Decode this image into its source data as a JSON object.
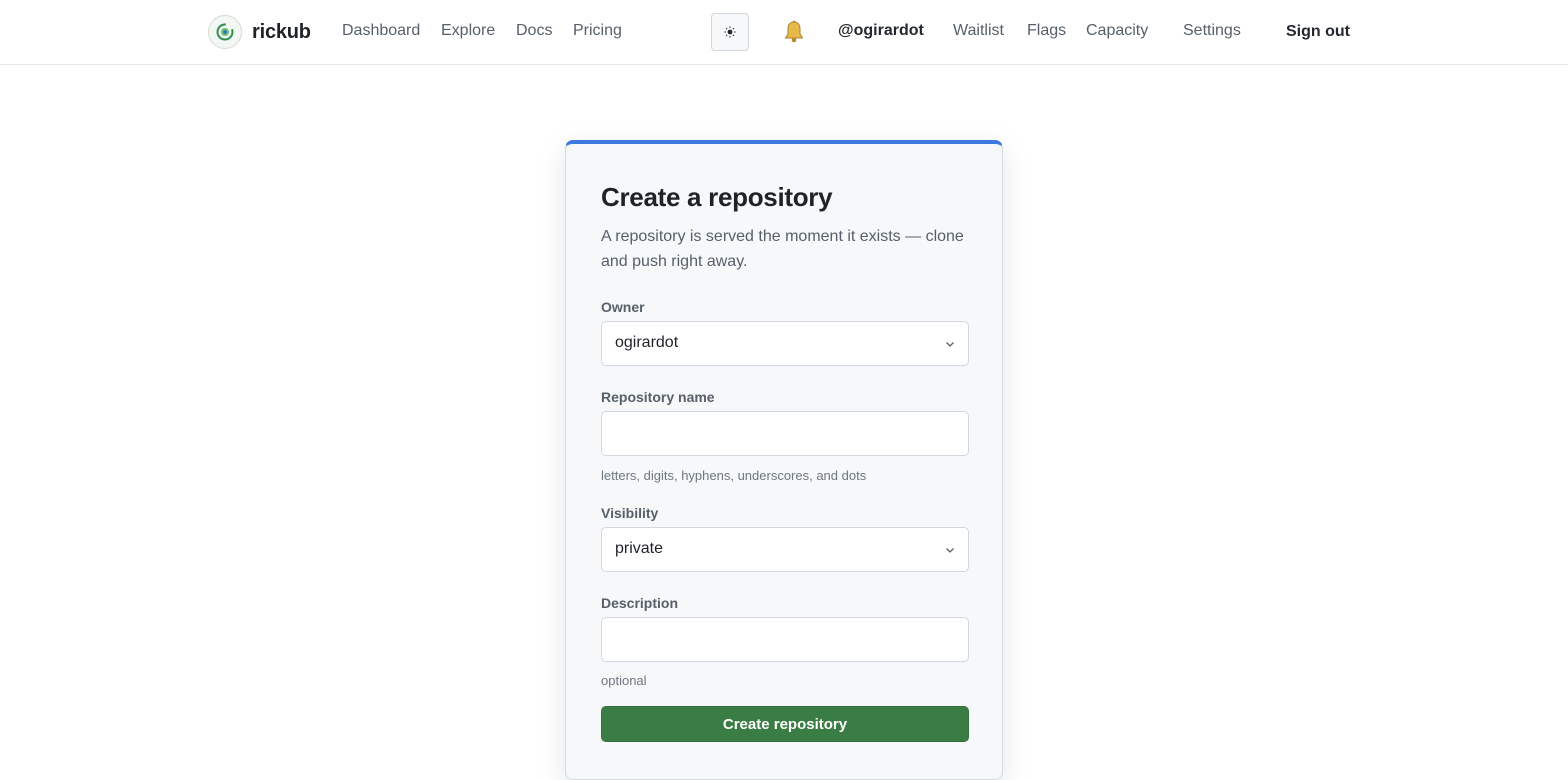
{
  "app": {
    "name": "rickub"
  },
  "nav": {
    "links": [
      "Dashboard",
      "Explore",
      "Docs",
      "Pricing"
    ],
    "user": "@ogirardot",
    "admin_links": [
      "Waitlist",
      "Flags",
      "Capacity"
    ],
    "settings": "Settings",
    "sign_out": "Sign out",
    "theme_icon": "sun-icon",
    "notifications_icon": "bell-icon"
  },
  "form": {
    "title": "Create a repository",
    "description": "A repository is served the moment it exists — clone and push right away.",
    "owner": {
      "label": "Owner",
      "value": "ogirardot"
    },
    "repo_name": {
      "label": "Repository name",
      "value": "",
      "hint": "letters, digits, hyphens, underscores, and dots"
    },
    "visibility": {
      "label": "Visibility",
      "value": "private"
    },
    "description_field": {
      "label": "Description",
      "value": "",
      "hint": "optional"
    },
    "submit_label": "Create repository"
  },
  "colors": {
    "accent": "#3b7be0",
    "primary_button": "#3a7d44",
    "logo_ring": "#2f8f4e"
  }
}
